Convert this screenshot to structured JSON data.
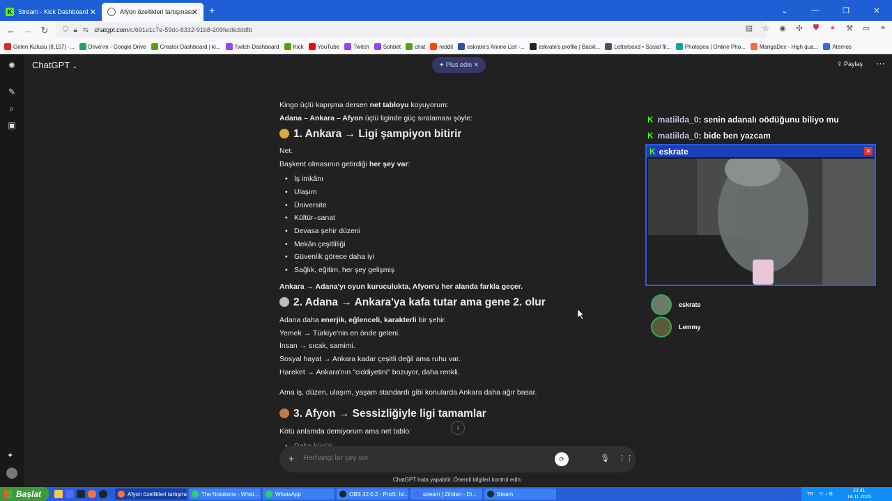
{
  "browser": {
    "tabs": [
      {
        "label": "Stream - Kick Dashboard",
        "active": false,
        "icon": "kick-icon",
        "color": "#53fc18"
      },
      {
        "label": "Afyon özellikleri tartışması",
        "active": true,
        "icon": "chatgpt-icon",
        "color": "#666666"
      }
    ],
    "url_prefix": "chatgpt.com",
    "url_rest": "/c/691e1c7e-59dc-8332-91b8-209fed6cbb8b",
    "bookmarks": [
      {
        "label": "Gelen Kutusu (8.157) -...",
        "color": "#d93025"
      },
      {
        "label": "Drive'ım - Google Drive",
        "color": "#1fa463"
      },
      {
        "label": "Creator Dashboard | ki...",
        "color": "#53a318"
      },
      {
        "label": "Twitch Dashboard",
        "color": "#9146ff"
      },
      {
        "label": "Kick",
        "color": "#53a318"
      },
      {
        "label": "YouTube",
        "color": "#ff0000"
      },
      {
        "label": "Twitch",
        "color": "#9146ff"
      },
      {
        "label": "Sohbet",
        "color": "#9146ff"
      },
      {
        "label": "chat",
        "color": "#53a318"
      },
      {
        "label": "reddit",
        "color": "#ff4500"
      },
      {
        "label": "eskrate's Anime List -...",
        "color": "#2e51a2"
      },
      {
        "label": "eskrate's profile | Backl...",
        "color": "#222222"
      },
      {
        "label": "Letterboxd • Social fil...",
        "color": "#445566"
      },
      {
        "label": "Photopea | Online Pho...",
        "color": "#18a497"
      },
      {
        "label": "MangaDex - High qua...",
        "color": "#ff6740"
      },
      {
        "label": "Aternos",
        "color": "#2f6fdf"
      }
    ]
  },
  "app": {
    "title": "ChatGPT",
    "plus_label": "Plus edin",
    "share_label": "Paylaş"
  },
  "message": {
    "intro_1_a": "Kingo üçlü kapışma dersen ",
    "intro_1_b": "net tabloyu",
    "intro_1_c": " koyuyorum:",
    "intro_2_a": "Adana – Ankara – Afyon",
    "intro_2_b": " üçlü liginde güç sıralaması şöyle:",
    "h1": "1. Ankara → Ligi şampiyon bitirir",
    "p_net": "Net.",
    "p_baskent_a": "Başkent olmasının getirdiği ",
    "p_baskent_b": "her şey var",
    "p_baskent_c": ":",
    "list1": [
      "İş imkânı",
      "Ulaşım",
      "Üniversite",
      "Kültür–sanat",
      "Devasa şehir düzeni",
      "Mekân çeşitliliği",
      "Güvenlik görece daha iyi",
      "Sağlık, eğitim, her şey gelişmiş"
    ],
    "p_ankara_summary": "Ankara → Adana'yı oyun kuruculukta, Afyon'u her alanda farkla geçer.",
    "h2": "2. Adana → Ankara'ya kafa tutar ama gene 2. olur",
    "p_adana_a": "Adana daha ",
    "p_adana_b": "enerjik, eğlenceli, karakterli",
    "p_adana_c": " bir şehir.",
    "p_yemek": "Yemek → Türkiye'nin en önde geleni.",
    "p_insan": "İnsan → sıcak, samimi.",
    "p_sosyal": "Sosyal hayat → Ankara kadar çeşitli değil ama ruhu var.",
    "p_hareket": "Hareket → Ankara'nın \"ciddiyetini\" bozuyor, daha renkli.",
    "p_ama": "Ama iş, düzen, ulaşım, yaşam standardı gibi konularda Ankara daha ağır basar.",
    "h3": "3. Afyon → Sessizliğiyle ligi tamamlar",
    "p_kotu": "Kötü anlamda demiyorum ama net tablo:",
    "list3_first": "Daha küçük"
  },
  "composer": {
    "placeholder": "Herhangi bir şey sor",
    "disclaimer": "ChatGPT hata yapabilir. Önemli bilgileri kontrol edin."
  },
  "overlay": {
    "chat": [
      {
        "user": "matiilda_0",
        "text": ": senin adanalı oödüğunu biliyo mu"
      },
      {
        "user": "matiilda_0",
        "text": ": bide ben yazcam"
      }
    ],
    "cam_title": "eskrate",
    "voice_users": [
      "eskrate",
      "Lemmy"
    ]
  },
  "taskbar": {
    "start_label": "Başlat",
    "items": [
      {
        "label": "Afyon özellikleri tartışma...",
        "color": "#ff7139",
        "active": true
      },
      {
        "label": "The Notations - What...",
        "color": "#25d366",
        "active": false
      },
      {
        "label": "WhatsApp",
        "color": "#25d366",
        "active": false
      },
      {
        "label": "OBS 32.0.2 - Profil: İsi...",
        "color": "#222222",
        "active": false
      },
      {
        "label": "stream | Zindan - Di...",
        "color": "#5865f2",
        "active": false
      },
      {
        "label": "Steam",
        "color": "#1b2838",
        "active": false
      }
    ],
    "lang": "TR",
    "time": "22:41",
    "date": "19.11.2025"
  },
  "colors": {
    "accent_blue": "#245edb",
    "kick_green": "#53fc18",
    "chat_bg": "#212121"
  }
}
